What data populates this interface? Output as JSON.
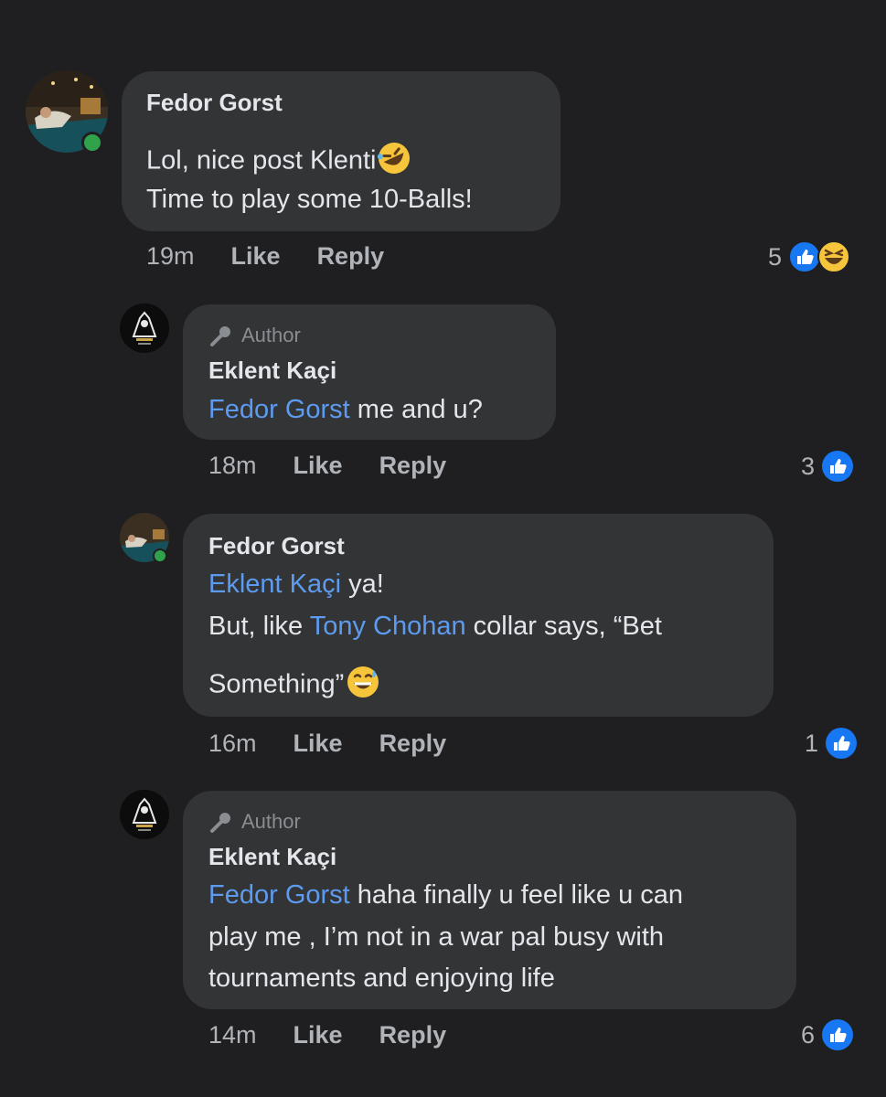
{
  "comments": [
    {
      "name": "Fedor Gorst",
      "lines": [
        {
          "text": "Lol, nice post Klenti"
        },
        {
          "text": "Time to play some 10-Balls!"
        }
      ],
      "time": "19m",
      "like": "Like",
      "reply": "Reply",
      "reaction_count": "5",
      "reaction_icons": [
        "like-icon",
        "haha-icon"
      ]
    },
    {
      "author_tag": "Author",
      "name": "Eklent Kaçi",
      "mention": "Fedor Gorst",
      "text": " me and u?",
      "time": "18m",
      "like": "Like",
      "reply": "Reply",
      "reaction_count": "3",
      "reaction_icons": [
        "like-icon"
      ]
    },
    {
      "name": "Fedor Gorst",
      "mention1": "Eklent Kaçi",
      "text1": " ya!",
      "text2a": "But, like ",
      "mention2": "Tony Chohan",
      "text2b": " collar says, “Bet",
      "text3": "Something”",
      "time": "16m",
      "like": "Like",
      "reply": "Reply",
      "reaction_count": "1",
      "reaction_icons": [
        "like-icon"
      ]
    },
    {
      "author_tag": "Author",
      "name": "Eklent Kaçi",
      "mention": "Fedor Gorst",
      "text1": " haha finally u feel like u can",
      "text2": "play me , I’m not in a war pal busy with",
      "text3": "tournaments and enjoying life",
      "time": "14m",
      "like": "Like",
      "reply": "Reply",
      "reaction_count": "6",
      "reaction_icons": [
        "like-icon"
      ]
    }
  ],
  "colors": {
    "background": "#1f1f21",
    "bubble": "#333436",
    "mention": "#5d9bf0",
    "like_blue": "#1877f2",
    "online": "#31a24c"
  }
}
